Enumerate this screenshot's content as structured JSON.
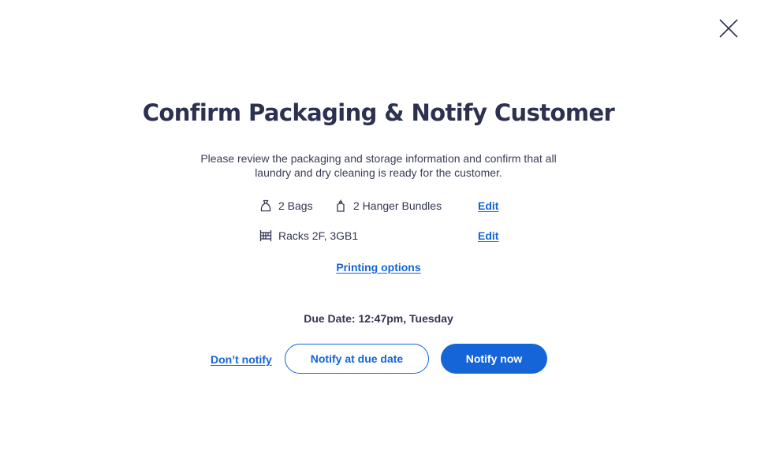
{
  "dialog": {
    "title": "Confirm Packaging & Notify Customer",
    "description": "Please review the packaging and storage information and confirm that all laundry and dry cleaning is ready for the customer.",
    "close_icon": "close-icon"
  },
  "packaging": {
    "bags_icon": "bag-icon",
    "bags_label": "2 Bags",
    "hangers_icon": "hanger-bundle-icon",
    "hangers_label": "2 Hanger Bundles",
    "edit_label": "Edit"
  },
  "storage": {
    "racks_icon": "rack-icon",
    "racks_label": "Racks 2F, 3GB1",
    "edit_label": "Edit"
  },
  "printing_options_label": "Printing options",
  "due_date_text": "Due Date: 12:47pm, Tuesday",
  "actions": {
    "dont_notify_label": "Don’t notify",
    "notify_due_label": "Notify at due date",
    "notify_now_label": "Notify now"
  },
  "colors": {
    "accent": "#1565d8",
    "title_text": "#2d3150",
    "body_text": "#333650"
  }
}
